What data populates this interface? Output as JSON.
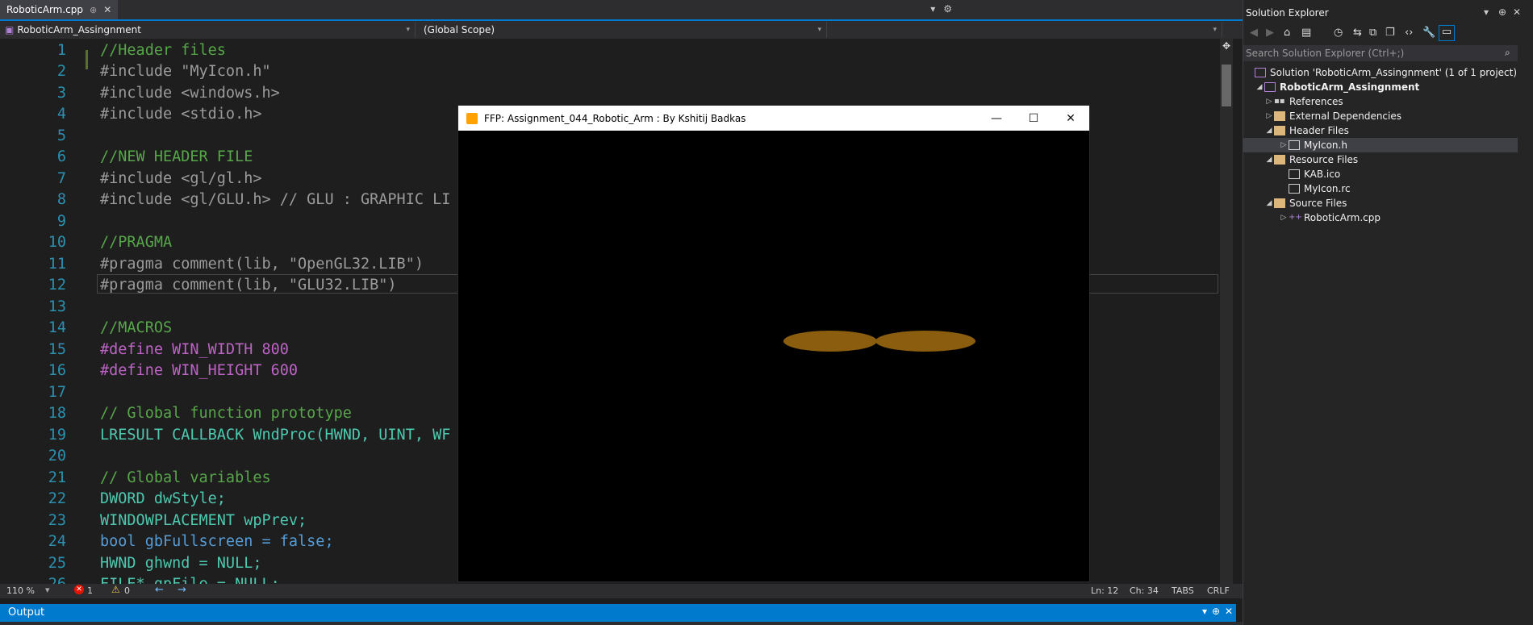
{
  "tab": {
    "filename": "RoboticArm.cpp",
    "pin": "⊕",
    "close": "✕"
  },
  "nav": {
    "project": "RoboticArm_Assingnment",
    "scope": "(Global Scope)",
    "member": ""
  },
  "code_lines": [
    {
      "n": "1",
      "t": "//Header files"
    },
    {
      "n": "2",
      "t": "#include \"MyIcon.h\""
    },
    {
      "n": "3",
      "t": "#include <windows.h>"
    },
    {
      "n": "4",
      "t": "#include <stdio.h>"
    },
    {
      "n": "5",
      "t": ""
    },
    {
      "n": "6",
      "t": "//NEW HEADER FILE"
    },
    {
      "n": "7",
      "t": "#include <gl/gl.h>"
    },
    {
      "n": "8",
      "t": "#include <gl/GLU.h> // GLU : GRAPHIC LI"
    },
    {
      "n": "9",
      "t": ""
    },
    {
      "n": "10",
      "t": "//PRAGMA"
    },
    {
      "n": "11",
      "t": "#pragma comment(lib, \"OpenGL32.LIB\")"
    },
    {
      "n": "12",
      "t": "#pragma comment(lib, \"GLU32.LIB\")"
    },
    {
      "n": "13",
      "t": ""
    },
    {
      "n": "14",
      "t": "//MACROS"
    },
    {
      "n": "15",
      "t": "#define WIN_WIDTH 800"
    },
    {
      "n": "16",
      "t": "#define WIN_HEIGHT 600"
    },
    {
      "n": "17",
      "t": ""
    },
    {
      "n": "18",
      "t": "// Global function prototype"
    },
    {
      "n": "19",
      "t": "LRESULT CALLBACK WndProc(HWND, UINT, WF"
    },
    {
      "n": "20",
      "t": ""
    },
    {
      "n": "21",
      "t": "// Global variables"
    },
    {
      "n": "22",
      "t": "DWORD dwStyle;"
    },
    {
      "n": "23",
      "t": "WINDOWPLACEMENT wpPrev;"
    },
    {
      "n": "24",
      "t": "bool gbFullscreen = false;"
    },
    {
      "n": "25",
      "t": "HWND ghwnd = NULL;"
    },
    {
      "n": "26",
      "t": "FILE* gpFile = NULL;"
    }
  ],
  "status": {
    "zoom": "110 %",
    "errors": "1",
    "warnings": "0",
    "line": "Ln: 12",
    "col": "Ch: 34",
    "tabs": "TABS",
    "eol": "CRLF"
  },
  "output": {
    "title": "Output"
  },
  "solution_explorer": {
    "title": "Solution Explorer",
    "search_placeholder": "Search Solution Explorer (Ctrl+;)",
    "items": [
      {
        "label": "Solution 'RoboticArm_Assingnment' (1 of 1 project)"
      },
      {
        "label": "RoboticArm_Assingnment"
      },
      {
        "label": "References"
      },
      {
        "label": "External Dependencies"
      },
      {
        "label": "Header Files"
      },
      {
        "label": "MyIcon.h"
      },
      {
        "label": "Resource Files"
      },
      {
        "label": "KAB.ico"
      },
      {
        "label": "MyIcon.rc"
      },
      {
        "label": "Source Files"
      },
      {
        "label": "RoboticArm.cpp"
      }
    ]
  },
  "gl_window": {
    "title": "FFP: Assignment_044_Robotic_Arm : By Kshitij Badkas",
    "shape_color": "#8b5e0f"
  },
  "colors": {
    "accent": "#007acc",
    "editor_bg": "#1e1e1e"
  }
}
